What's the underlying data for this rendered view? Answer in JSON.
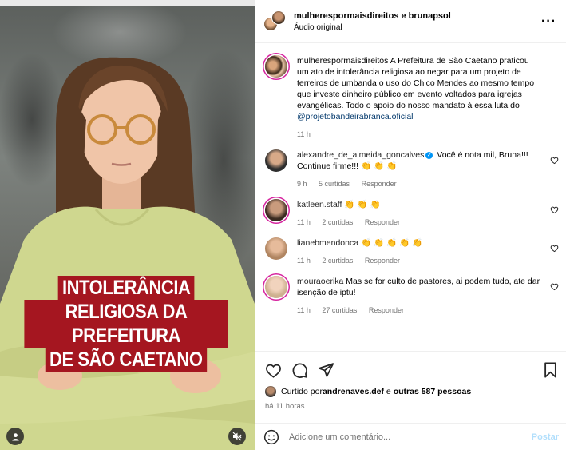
{
  "media": {
    "overlay_lines": [
      "INTOLERÂNCIA",
      "RELIGIOSA DA PREFEITURA",
      "DE SÃO CAETANO"
    ]
  },
  "header": {
    "title": "mulherespormaisdireitos e brunapsol",
    "subtitle": "Áudio original"
  },
  "caption": {
    "user": "mulherespormaisdireitos",
    "text": " A Prefeitura de São Caetano praticou um ato de intolerância religiosa ao negar para um projeto de terreiros de umbanda o uso do Chico Mendes ao mesmo tempo que investe dinheiro público em evento voltados para igrejas evangélicas. Todo o apoio do nosso mandato à essa luta do ",
    "mention": "@projetobandeirabranca.oficial",
    "time": "11 h"
  },
  "comments": [
    {
      "user": "alexandre_de_almeida_goncalves",
      "text": " Você é nota mil, Bruna!!! Continue firme!!! ",
      "emoji": "👏👏👏",
      "time": "9 h",
      "likes": "5 curtidas",
      "reply": "Responder"
    },
    {
      "user": "katleen.staff",
      "text": " ",
      "emoji": "👏👏👏",
      "time": "11 h",
      "likes": "2 curtidas",
      "reply": "Responder"
    },
    {
      "user": "lianebmendonca",
      "text": " ",
      "emoji": "👏👏👏👏👏",
      "time": "11 h",
      "likes": "2 curtidas",
      "reply": "Responder"
    },
    {
      "user": "mouraoerika",
      "text": " Mas se for culto de pastores, ai podem tudo, ate dar isenção de iptu!",
      "emoji": "",
      "time": "11 h",
      "likes": "27 curtidas",
      "reply": "Responder"
    }
  ],
  "likes": {
    "prefix": "Curtido por ",
    "user": "andrenaves.def",
    "middle": " e ",
    "others": "outras 587 pessoas"
  },
  "post_time": "há 11 horas",
  "add_comment": {
    "placeholder": "Adicione um comentário...",
    "post_label": "Postar"
  },
  "colors": {
    "accent": "#a51620",
    "link": "#00376b",
    "post_disabled": "#b2dffc"
  }
}
